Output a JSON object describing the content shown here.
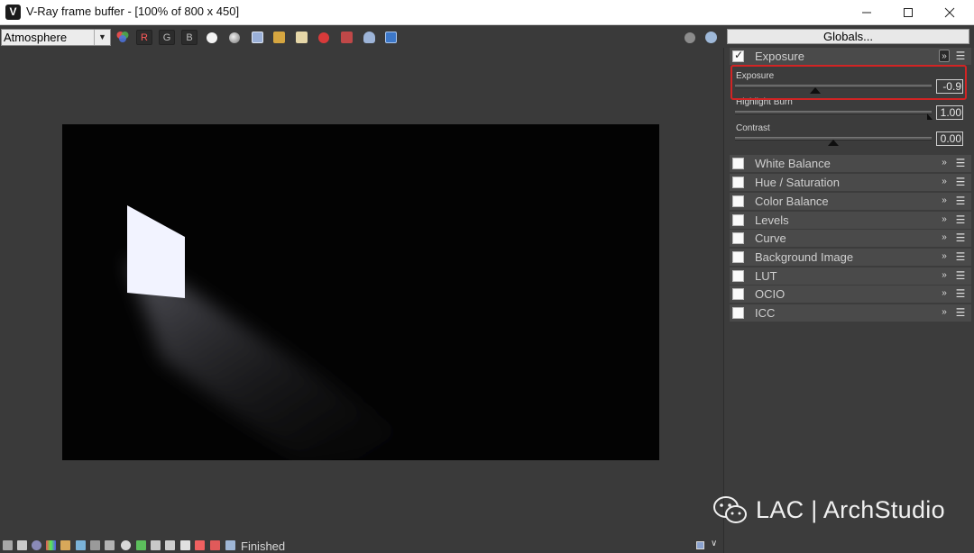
{
  "window": {
    "title": "V-Ray frame buffer - [100% of 800 x 450]",
    "app_icon": "vray-logo",
    "controls": [
      "minimize-icon",
      "maximize-icon",
      "close-icon"
    ]
  },
  "toolbar": {
    "channel_select": "Atmosphere",
    "buttons": [
      {
        "name": "color-wheel-icon"
      },
      {
        "name": "red-channel",
        "label": "R"
      },
      {
        "name": "green-channel",
        "label": "G"
      },
      {
        "name": "blue-channel",
        "label": "B"
      },
      {
        "name": "white-circle-icon"
      },
      {
        "name": "alpha-circle-icon"
      },
      {
        "name": "save-icon"
      },
      {
        "name": "open-folder-icon"
      },
      {
        "name": "clear-icon"
      },
      {
        "name": "stop-icon"
      },
      {
        "name": "region-icon"
      },
      {
        "name": "teapot-icon"
      },
      {
        "name": "render-history-icon"
      }
    ],
    "right_icons": [
      "globe-icon",
      "teapot-render-icon"
    ]
  },
  "globals_button": "Globals...",
  "panel": {
    "exposure": {
      "label": "Exposure",
      "checked": true,
      "sliders": [
        {
          "label": "Exposure",
          "value": "-0.9"
        },
        {
          "label": "Highlight Burn",
          "value": "1.00"
        },
        {
          "label": "Contrast",
          "value": "0.00"
        }
      ]
    },
    "layers": [
      {
        "label": "White Balance",
        "checked": false
      },
      {
        "label": "Hue / Saturation",
        "checked": false
      },
      {
        "label": "Color Balance",
        "checked": false
      },
      {
        "label": "Levels",
        "checked": false
      },
      {
        "label": "Curve",
        "checked": false
      },
      {
        "label": "Background Image",
        "checked": false
      },
      {
        "label": "LUT",
        "checked": false
      },
      {
        "label": "OCIO",
        "checked": false
      },
      {
        "label": "ICC",
        "checked": false
      }
    ]
  },
  "status": {
    "text": "Finished"
  },
  "watermark": {
    "text": "LAC | ArchStudio",
    "icon": "wechat-icon"
  },
  "colors": {
    "highlight": "#d22424",
    "panel_bg": "#3c3c3c",
    "render_bg": "#030303"
  }
}
